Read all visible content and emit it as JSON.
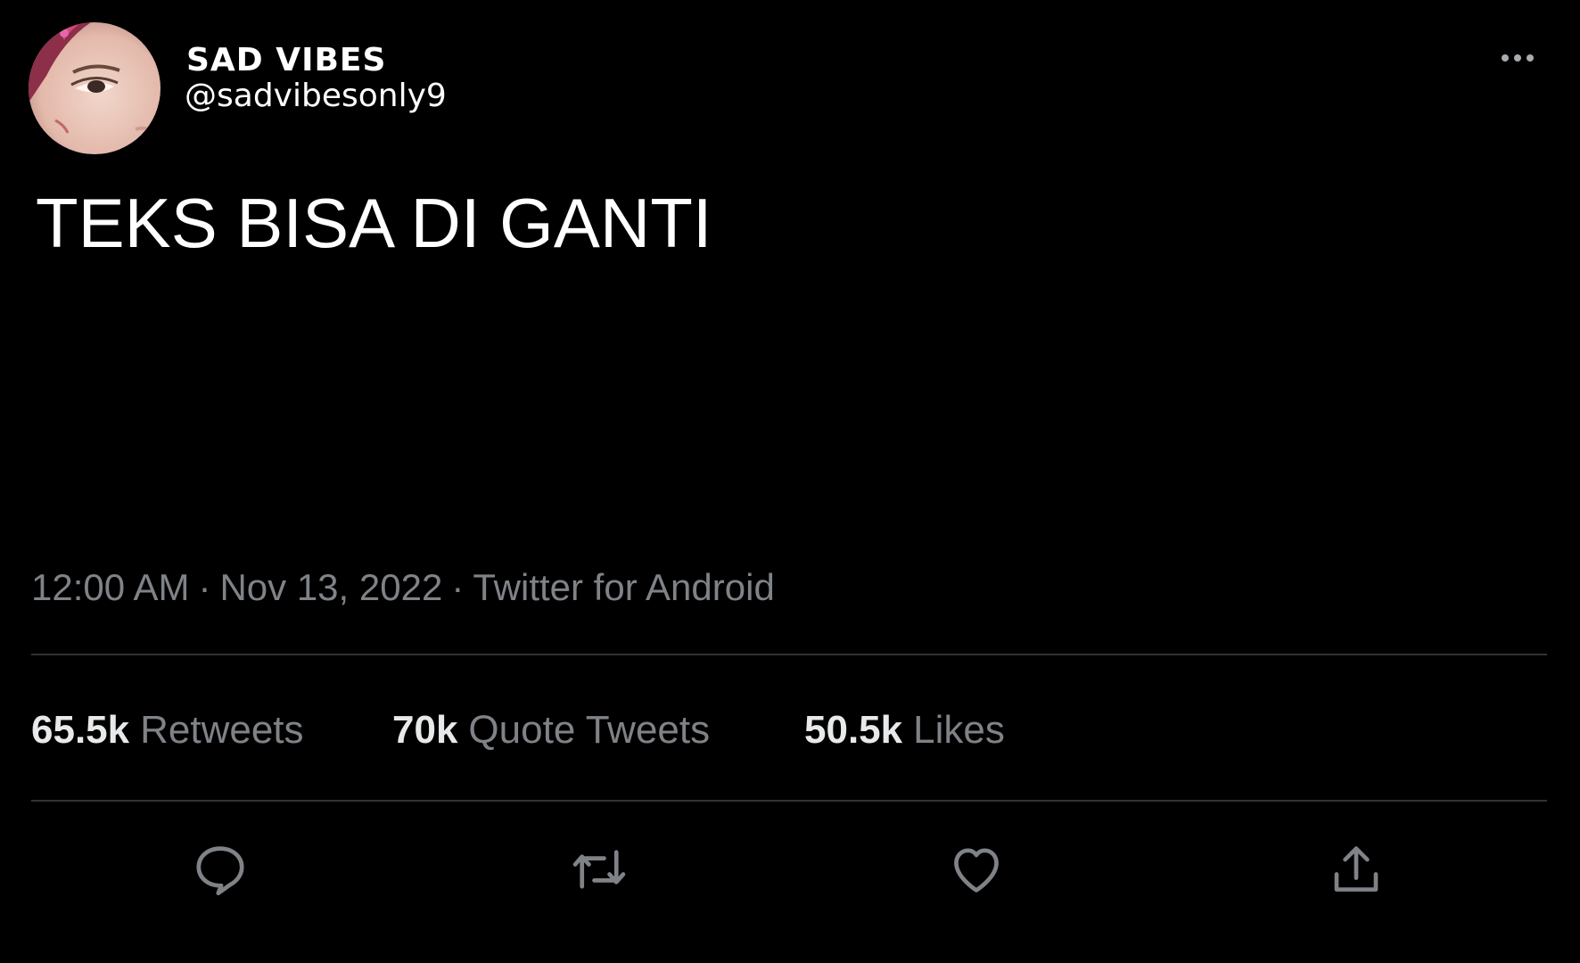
{
  "user": {
    "display_name": "SAD VIBES",
    "handle": "@sadvibesonly9"
  },
  "tweet": {
    "text": "TEKS BISA DI GANTI",
    "time": "12:00 AM",
    "date": "Nov 13, 2022",
    "source": "Twitter for Android",
    "separator": "·"
  },
  "stats": {
    "retweets_count": "65.5k",
    "retweets_label": "Retweets",
    "quotes_count": "70k",
    "quotes_label": "Quote Tweets",
    "likes_count": "50.5k",
    "likes_label": "Likes"
  },
  "actions": [
    "reply-icon",
    "retweet-icon",
    "like-icon",
    "share-icon"
  ],
  "colors": {
    "background": "#000000",
    "text": "#ffffff",
    "secondary_text": "#7f8387",
    "divider": "#2f3336",
    "icon": "#7f8387"
  }
}
